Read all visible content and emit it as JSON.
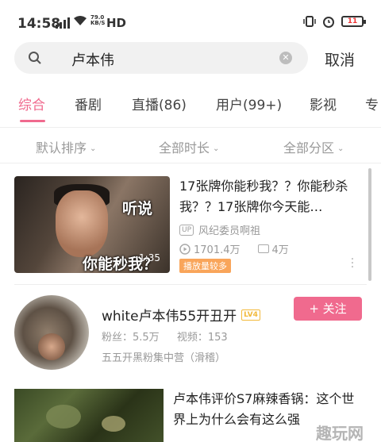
{
  "status_bar": {
    "time": "14:58",
    "network_speed_top": "79.0",
    "network_speed_bottom": "KB/S",
    "hd": "HD",
    "battery": "11"
  },
  "search": {
    "query": "卢本伟",
    "cancel_label": "取消"
  },
  "tabs": [
    {
      "label": "综合",
      "active": true
    },
    {
      "label": "番剧"
    },
    {
      "label": "直播(86)"
    },
    {
      "label": "用户(99+)"
    },
    {
      "label": "影视"
    },
    {
      "label": "专"
    }
  ],
  "filters": [
    {
      "label": "默认排序"
    },
    {
      "label": "全部时长"
    },
    {
      "label": "全部分区"
    }
  ],
  "results": {
    "video1": {
      "title": "17张牌你能秒我？？你能秒杀我？？17张牌你今天能…",
      "thumb_text_top": "听说",
      "thumb_text_bottom": "你能秒我？",
      "duration": "1:35",
      "up_badge": "UP",
      "uploader": "风纪委员啊祖",
      "plays": "1701.4万",
      "danmaku": "4万",
      "tag": "播放量较多"
    },
    "user": {
      "name": "white卢本伟55开丑开",
      "level": "LV4",
      "follow_label": "+ 关注",
      "fans": "粉丝：5.5万",
      "videos": "视频：153",
      "signature": "五五开黑粉集中营（滑稽）"
    },
    "video3": {
      "title": "卢本伟评价S7麻辣香锅：这个世界上为什么会有这么强"
    }
  },
  "watermark": "趣玩网",
  "colors": {
    "accent": "#f06a8e",
    "hot_tag": "#f9a55a",
    "level": "#f2b93b"
  }
}
